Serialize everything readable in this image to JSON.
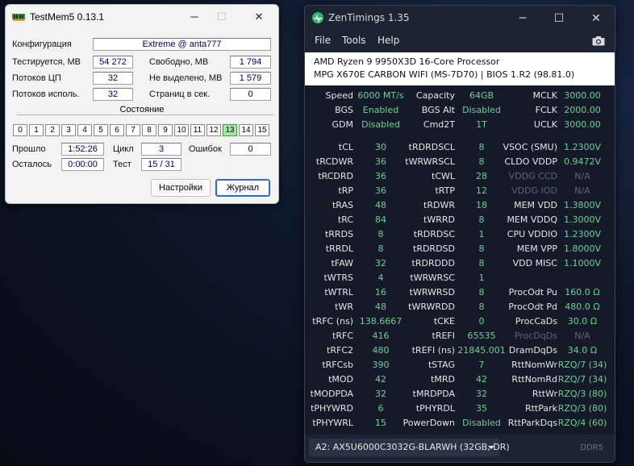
{
  "testmem": {
    "title": "TestMem5  0.13.1",
    "config_label": "Конфигурация",
    "config_value": "Extreme @ anta777",
    "rows": [
      {
        "l1": "Тестируется, MB",
        "v1": "54 272",
        "l2": "Свободно, MB",
        "v2": "1 794"
      },
      {
        "l1": "Потоков ЦП",
        "v1": "32",
        "l2": "Не выделено, MB",
        "v2": "1 579"
      },
      {
        "l1": "Потоков исполь.",
        "v1": "32",
        "l2": "Страниц в сек.",
        "v2": "0"
      }
    ],
    "state_label": "Состояние",
    "cells": [
      "0",
      "1",
      "2",
      "3",
      "4",
      "5",
      "6",
      "7",
      "8",
      "9",
      "10",
      "11",
      "12",
      "13",
      "14",
      "15"
    ],
    "active_cell": 13,
    "elapsed_label": "Прошло",
    "elapsed_value": "1:52:26",
    "cycle_label": "Цикл",
    "cycle_value": "3",
    "errors_label": "Ошибок",
    "errors_value": "0",
    "remaining_label": "Осталось",
    "remaining_value": "0:00:00",
    "test_label": "Тест",
    "test_value": "15 / 31",
    "settings_button": "Настройки",
    "log_button": "Журнал",
    "window_controls": {
      "minimize": "─",
      "maximize": "☐",
      "close": "✕"
    }
  },
  "zentimings": {
    "title": "ZenTimings 1.35",
    "menu": [
      "File",
      "Tools",
      "Help"
    ],
    "cpu": "AMD Ryzen 9 9950X3D 16-Core Processor",
    "board": "MPG X670E CARBON WIFI (MS-7D70) | BIOS 1.R2 (98.81.0)",
    "top_rows": [
      [
        "Speed",
        "6000 MT/s",
        "Capacity",
        "64GB",
        "MCLK",
        "3000.00"
      ],
      [
        "BGS",
        "Enabled",
        "BGS Alt",
        "Disabled",
        "FCLK",
        "2000.00"
      ],
      [
        "GDM",
        "Disabled",
        "Cmd2T",
        "1T",
        "UCLK",
        "3000.00"
      ]
    ],
    "timing_rows": [
      [
        "tCL",
        "30",
        "tRDRDSCL",
        "8",
        "VSOC (SMU)",
        "1.2300V"
      ],
      [
        "tRCDWR",
        "36",
        "tWRWRSCL",
        "8",
        "CLDO VDDP",
        "0.9472V"
      ],
      [
        "tRCDRD",
        "36",
        "tCWL",
        "28",
        "VDDG CCD",
        "N/A"
      ],
      [
        "tRP",
        "36",
        "tRTP",
        "12",
        "VDDG IOD",
        "N/A"
      ],
      [
        "tRAS",
        "48",
        "tRDWR",
        "18",
        "MEM VDD",
        "1.3800V"
      ],
      [
        "tRC",
        "84",
        "tWRRD",
        "8",
        "MEM VDDQ",
        "1.3000V"
      ],
      [
        "tRRDS",
        "8",
        "tRDRDSC",
        "1",
        "CPU VDDIO",
        "1.2300V"
      ],
      [
        "tRRDL",
        "8",
        "tRDRDSD",
        "8",
        "MEM VPP",
        "1.8000V"
      ],
      [
        "tFAW",
        "32",
        "tRDRDDD",
        "8",
        "VDD MISC",
        "1.1000V"
      ],
      [
        "tWTRS",
        "4",
        "tWRWRSC",
        "1",
        "",
        ""
      ],
      [
        "tWTRL",
        "16",
        "tWRWRSD",
        "8",
        "ProcOdt Pu",
        "160.0 Ω"
      ],
      [
        "tWR",
        "48",
        "tWRWRDD",
        "8",
        "ProcOdt Pd",
        "480.0 Ω"
      ],
      [
        "tRFC (ns)",
        "138.6667",
        "tCKE",
        "0",
        "ProcCaDs",
        "30.0 Ω"
      ],
      [
        "tRFC",
        "416",
        "tREFI",
        "65535",
        "ProcDqDs",
        "N/A"
      ],
      [
        "tRFC2",
        "480",
        "tREFI (ns)",
        "21845.001",
        "DramDqDs",
        "34.0 Ω"
      ],
      [
        "tRFCsb",
        "390",
        "tSTAG",
        "7",
        "RttNomWr",
        "RZQ/7 (34)"
      ],
      [
        "tMOD",
        "42",
        "tMRD",
        "42",
        "RttNomRd",
        "RZQ/7 (34)"
      ],
      [
        "tMODPDA",
        "32",
        "tMRDPDA",
        "32",
        "RttWr",
        "RZQ/3 (80)"
      ],
      [
        "tPHYWRD",
        "6",
        "tPHYRDL",
        "35",
        "RttPark",
        "RZQ/3 (80)"
      ],
      [
        "tPHYWRL",
        "15",
        "PowerDown",
        "Disabled",
        "RttParkDqs",
        "RZQ/4 (60)"
      ]
    ],
    "dim_labels": [
      "VDDG CCD",
      "VDDG IOD",
      "ProcDqDs"
    ],
    "module": "A2: AX5U6000C3032G-BLARWH (32GB, DR)",
    "ddr": "DDR5",
    "window_controls": {
      "minimize": "─",
      "maximize": "☐",
      "close": "✕"
    }
  },
  "colors": {
    "value_green": "#6fcf97",
    "dim": "#5d6575",
    "active_cell": "#a6e7a6"
  }
}
